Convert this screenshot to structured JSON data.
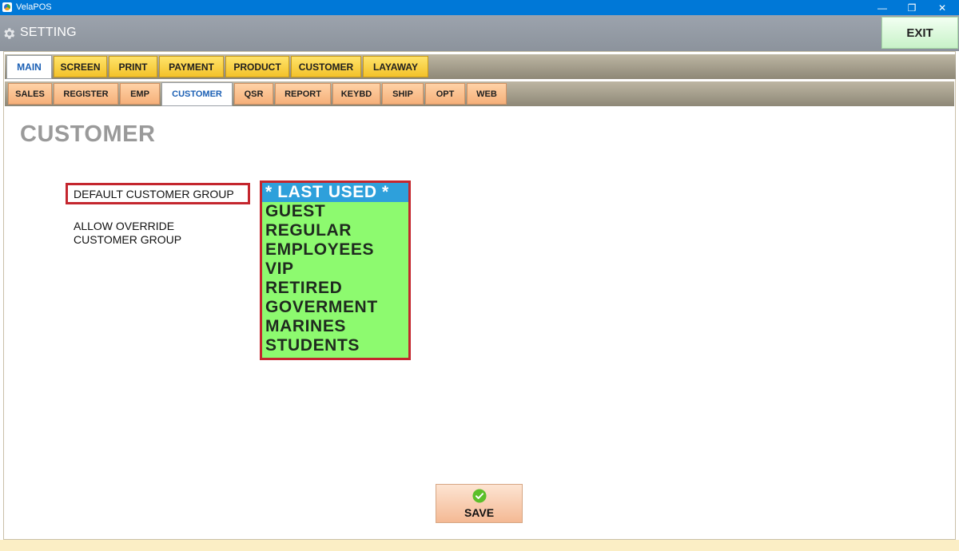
{
  "window": {
    "title": "VelaPOS",
    "icons": {
      "app": "velapos-logo-icon",
      "minimize": "minimize-icon",
      "maximize": "restore-icon",
      "close": "close-icon"
    },
    "controls": {
      "minimize": "—",
      "restore": "❐",
      "close": "✕"
    }
  },
  "header": {
    "title": "SETTING",
    "icon": "gear-icon",
    "exit_label": "EXIT"
  },
  "main_tabs": [
    {
      "label": "MAIN",
      "active": true
    },
    {
      "label": "SCREEN",
      "active": false
    },
    {
      "label": "PRINT",
      "active": false
    },
    {
      "label": "PAYMENT",
      "active": false
    },
    {
      "label": "PRODUCT",
      "active": false
    },
    {
      "label": "CUSTOMER",
      "active": false
    },
    {
      "label": "LAYAWAY",
      "active": false
    }
  ],
  "sub_tabs": [
    {
      "label": "SALES",
      "active": false
    },
    {
      "label": "REGISTER",
      "active": false
    },
    {
      "label": "EMP",
      "active": false
    },
    {
      "label": "CUSTOMER",
      "active": true
    },
    {
      "label": "QSR",
      "active": false
    },
    {
      "label": "REPORT",
      "active": false
    },
    {
      "label": "KEYBD",
      "active": false
    },
    {
      "label": "SHIP",
      "active": false
    },
    {
      "label": "OPT",
      "active": false
    },
    {
      "label": "WEB",
      "active": false
    }
  ],
  "page": {
    "title": "CUSTOMER",
    "default_group_label": "DEFAULT CUSTOMER GROUP",
    "allow_override_line1": "ALLOW OVERRIDE",
    "allow_override_line2": "CUSTOMER GROUP",
    "groups": [
      "* LAST USED *",
      "GUEST",
      "REGULAR",
      "EMPLOYEES",
      "VIP",
      "RETIRED",
      "GOVERMENT",
      "MARINES",
      "STUDENTS"
    ],
    "selected_group": "* LAST USED *",
    "save_label": "SAVE",
    "save_icon": "check-circle-icon"
  },
  "colors": {
    "titlebar": "#0078d7",
    "list_bg": "#8dfa6f",
    "list_selected": "#2ea0db",
    "highlight_border": "#c4262e",
    "main_tab": "#f3c22a",
    "sub_tab": "#f5b07a",
    "exit_button": "#c8f2c8"
  }
}
